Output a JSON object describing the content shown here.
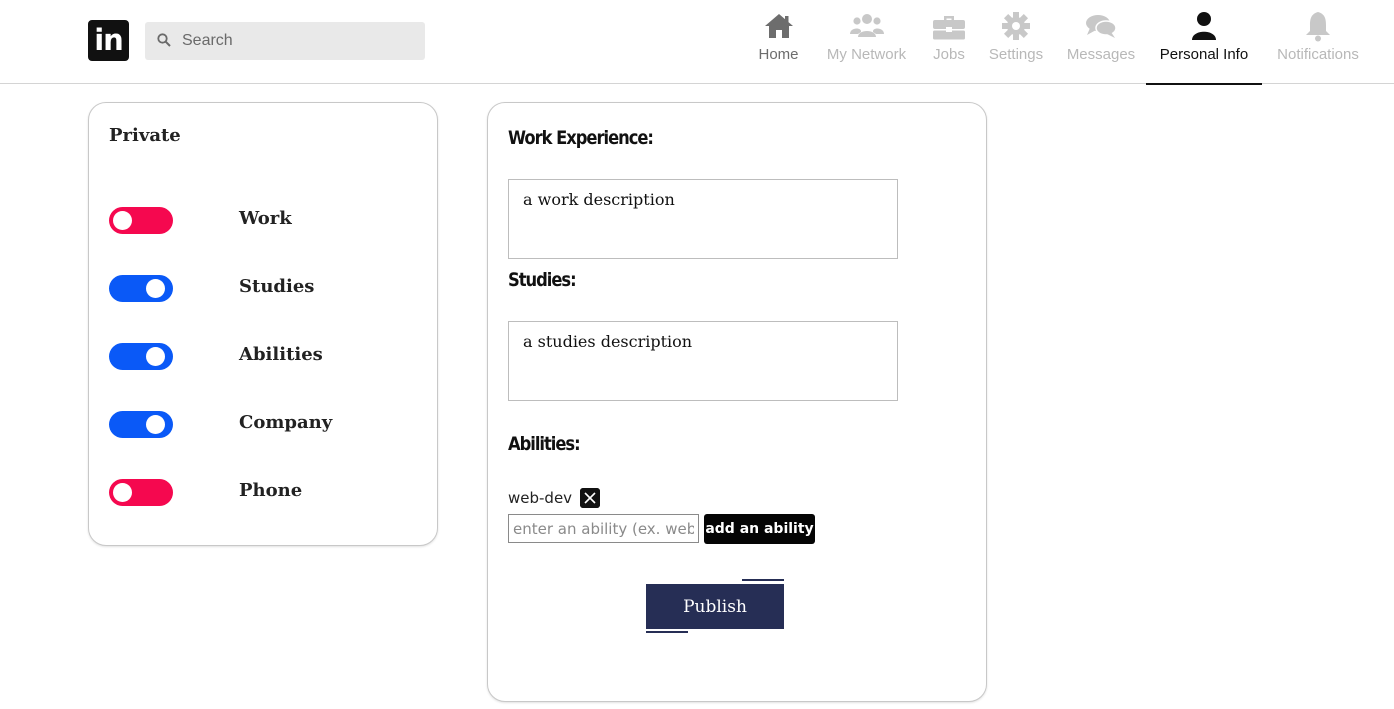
{
  "header": {
    "logo_text": "in",
    "search": {
      "placeholder": "Search"
    },
    "nav": [
      {
        "label": "Home",
        "icon": "home-icon"
      },
      {
        "label": "My Network",
        "icon": "users-icon"
      },
      {
        "label": "Jobs",
        "icon": "briefcase-icon"
      },
      {
        "label": "Settings",
        "icon": "gear-icon"
      },
      {
        "label": "Messages",
        "icon": "chat-bubbles-icon"
      },
      {
        "label": "Personal Info",
        "icon": "user-icon",
        "active": true
      },
      {
        "label": "Notifications",
        "icon": "bell-icon"
      }
    ]
  },
  "privacy": {
    "title": "Private",
    "toggles": [
      {
        "label": "Work",
        "state": "off"
      },
      {
        "label": "Studies",
        "state": "on"
      },
      {
        "label": "Abilities",
        "state": "on"
      },
      {
        "label": "Company",
        "state": "on"
      },
      {
        "label": "Phone",
        "state": "off"
      }
    ]
  },
  "form": {
    "work_title": "Work Experience:",
    "work_value": "a work description",
    "studies_title": "Studies:",
    "studies_value": "a studies description",
    "abilities_title": "Abilities:",
    "abilities": [
      "web-dev"
    ],
    "ability_input_placeholder": "enter an ability (ex. web-dev)",
    "add_ability_label": "add an ability",
    "publish_label": "Publish"
  },
  "colors": {
    "toggle_on": "#0a59f7",
    "toggle_off": "#f5084f",
    "publish_bg": "#262e55",
    "nav_active": "#111111",
    "nav_inactive": "#b8b8b8"
  }
}
